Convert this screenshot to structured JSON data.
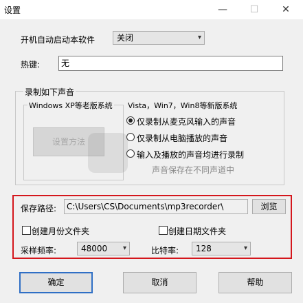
{
  "window": {
    "title": "设置",
    "min": "—",
    "max": "☐",
    "close": "✕"
  },
  "autostart": {
    "label": "开机自动启动本软件",
    "value": "关闭"
  },
  "hotkey": {
    "label": "热键:",
    "value": "无"
  },
  "record_group": {
    "title": "录制如下声音",
    "xp": {
      "title": "Windows XP等老版系统",
      "button": "设置方法"
    },
    "vista": {
      "title": "Vista，Win7，Win8等新版系统",
      "options": [
        "仅录制从麦克风输入的声音",
        "仅录制从电脑播放的声音",
        "输入及播放的声音均进行录制"
      ],
      "selected": 0,
      "note": "声音保存在不同声道中"
    }
  },
  "save": {
    "label": "保存路径:",
    "path": "C:\\Users\\CS\\Documents\\mp3recorder\\",
    "browse": "浏览"
  },
  "folders": {
    "monthly": "创建月份文件夹",
    "daily": "创建日期文件夹"
  },
  "samplerate": {
    "label": "采样频率:",
    "value": "48000"
  },
  "bitrate": {
    "label": "比特率:",
    "value": "128"
  },
  "buttons": {
    "ok": "确定",
    "cancel": "取消",
    "help": "帮助"
  },
  "colors": {
    "highlight": "#d4161c",
    "focus": "#2f6fc5"
  }
}
